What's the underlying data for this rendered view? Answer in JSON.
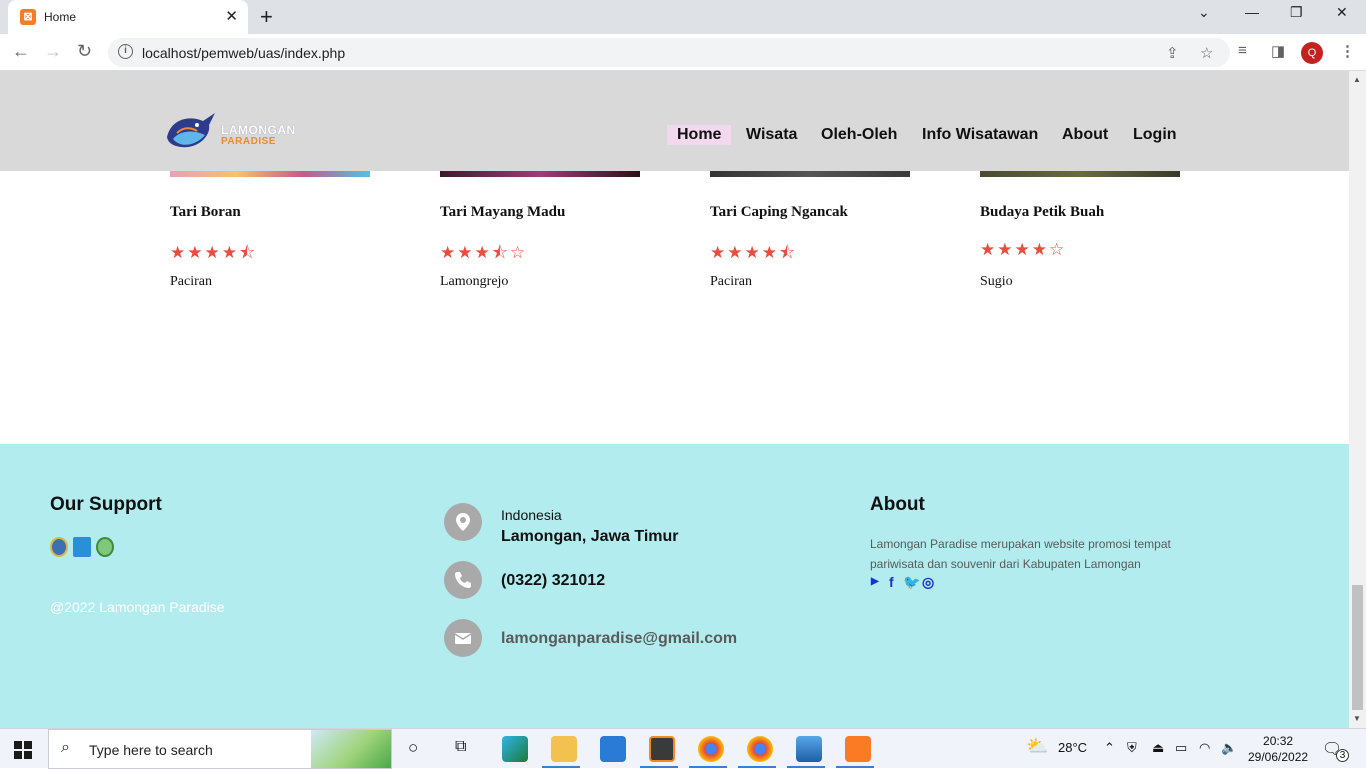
{
  "browser": {
    "tab_title": "Home",
    "tab_favicon": "xampp-icon",
    "url": "localhost/pemweb/uas/index.php",
    "profile_initial": "Q"
  },
  "site": {
    "logo_line1": "LAMONGAN",
    "logo_line2": "PARADISE",
    "nav": [
      "Home",
      "Wisata",
      "Oleh-Oleh",
      "Info Wisatawan",
      "About",
      "Login"
    ],
    "active_nav": "Home"
  },
  "cards": [
    {
      "title": "Tari Boran",
      "rating": 4.5,
      "stars": "★★★★⯪",
      "location": "Paciran"
    },
    {
      "title": "Tari Mayang Madu",
      "rating": 3.5,
      "stars": "★★★⯪☆",
      "location": "Lamongrejo"
    },
    {
      "title": "Tari Caping Ngancak",
      "rating": 4.5,
      "stars": "★★★★⯪",
      "location": "Paciran"
    },
    {
      "title": "Budaya Petik Buah",
      "rating": 4,
      "stars": "★★★★☆",
      "location": "Sugio"
    }
  ],
  "footer": {
    "support_heading": "Our Support",
    "copyright": "@2022 Lamongan Paradise",
    "country": "Indonesia",
    "city": "Lamongan, Jawa Timur",
    "phone": "(0322) 321012",
    "email": "lamonganparadise@gmail.com",
    "about_heading": "About",
    "about_text": "Lamongan Paradise merupakan website promosi tempat pariwisata dan souvenir dari Kabupaten Lamongan",
    "social_icons": [
      "youtube-icon",
      "facebook-icon",
      "twitter-icon",
      "instagram-icon"
    ]
  },
  "taskbar": {
    "search_placeholder": "Type here to search",
    "weather": "28°C",
    "time": "20:32",
    "date": "29/06/2022",
    "notification_count": "3"
  },
  "colors": {
    "header_bg": "#d9d9d9",
    "footer_bg": "#b2ecee",
    "star": "#ea4c3d",
    "social": "#1a2fd4"
  }
}
